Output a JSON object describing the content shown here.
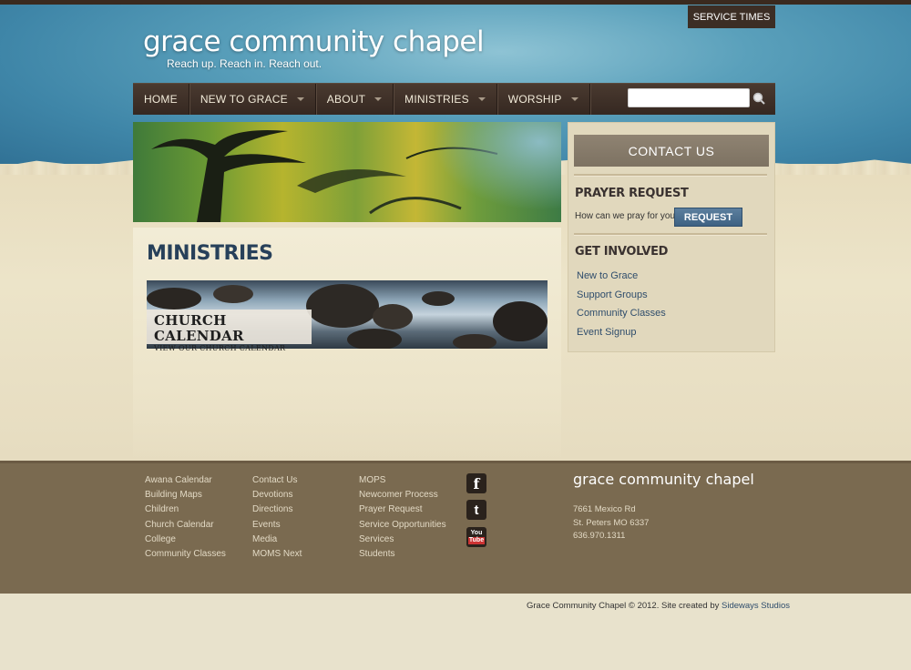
{
  "header": {
    "service_times": "SERVICE TIMES",
    "logo": "grace community chapel",
    "tagline": "Reach up. Reach in. Reach out."
  },
  "nav": {
    "items": [
      {
        "label": "HOME",
        "dropdown": false
      },
      {
        "label": "NEW TO GRACE",
        "dropdown": true
      },
      {
        "label": "ABOUT",
        "dropdown": true
      },
      {
        "label": "MINISTRIES",
        "dropdown": true
      },
      {
        "label": "WORSHIP",
        "dropdown": true
      }
    ],
    "search_placeholder": ""
  },
  "main": {
    "title": "MINISTRIES",
    "banner": {
      "title": "CHURCH CALENDAR",
      "subtitle": "VIEW OUR CHURCH CALENDAR"
    }
  },
  "sidebar": {
    "contact_label": "CONTACT US",
    "prayer_heading": "PRAYER REQUEST",
    "prayer_text": "How can we pray for you?",
    "request_label": "REQUEST",
    "involved_heading": "GET INVOLVED",
    "links": [
      "New to Grace",
      "Support Groups",
      "Community Classes",
      "Event Signup"
    ]
  },
  "footer": {
    "col1": [
      "Awana Calendar",
      "Building Maps",
      "Children",
      "Church Calendar",
      "College",
      "Community Classes"
    ],
    "col2": [
      "Contact Us",
      "Devotions",
      "Directions",
      "Events",
      "Media",
      "MOMS Next"
    ],
    "col3": [
      "MOPS",
      "Newcomer Process",
      "Prayer Request",
      "Service Opportunities",
      "Services",
      "Students"
    ],
    "social": [
      "facebook-icon",
      "twitter-icon",
      "youtube-icon"
    ],
    "logo": "grace community chapel",
    "address": [
      "7661 Mexico Rd",
      "St. Peters MO 6337",
      "636.970.1311"
    ],
    "copyright": "Grace Community Chapel © 2012. Site created by ",
    "credit": "Sideways Studios"
  },
  "colors": {
    "nav_bg": "#3c2e25",
    "accent_blue": "#27405a",
    "footer_bg": "#7a6a50",
    "request_btn": "#4a6d8e"
  }
}
